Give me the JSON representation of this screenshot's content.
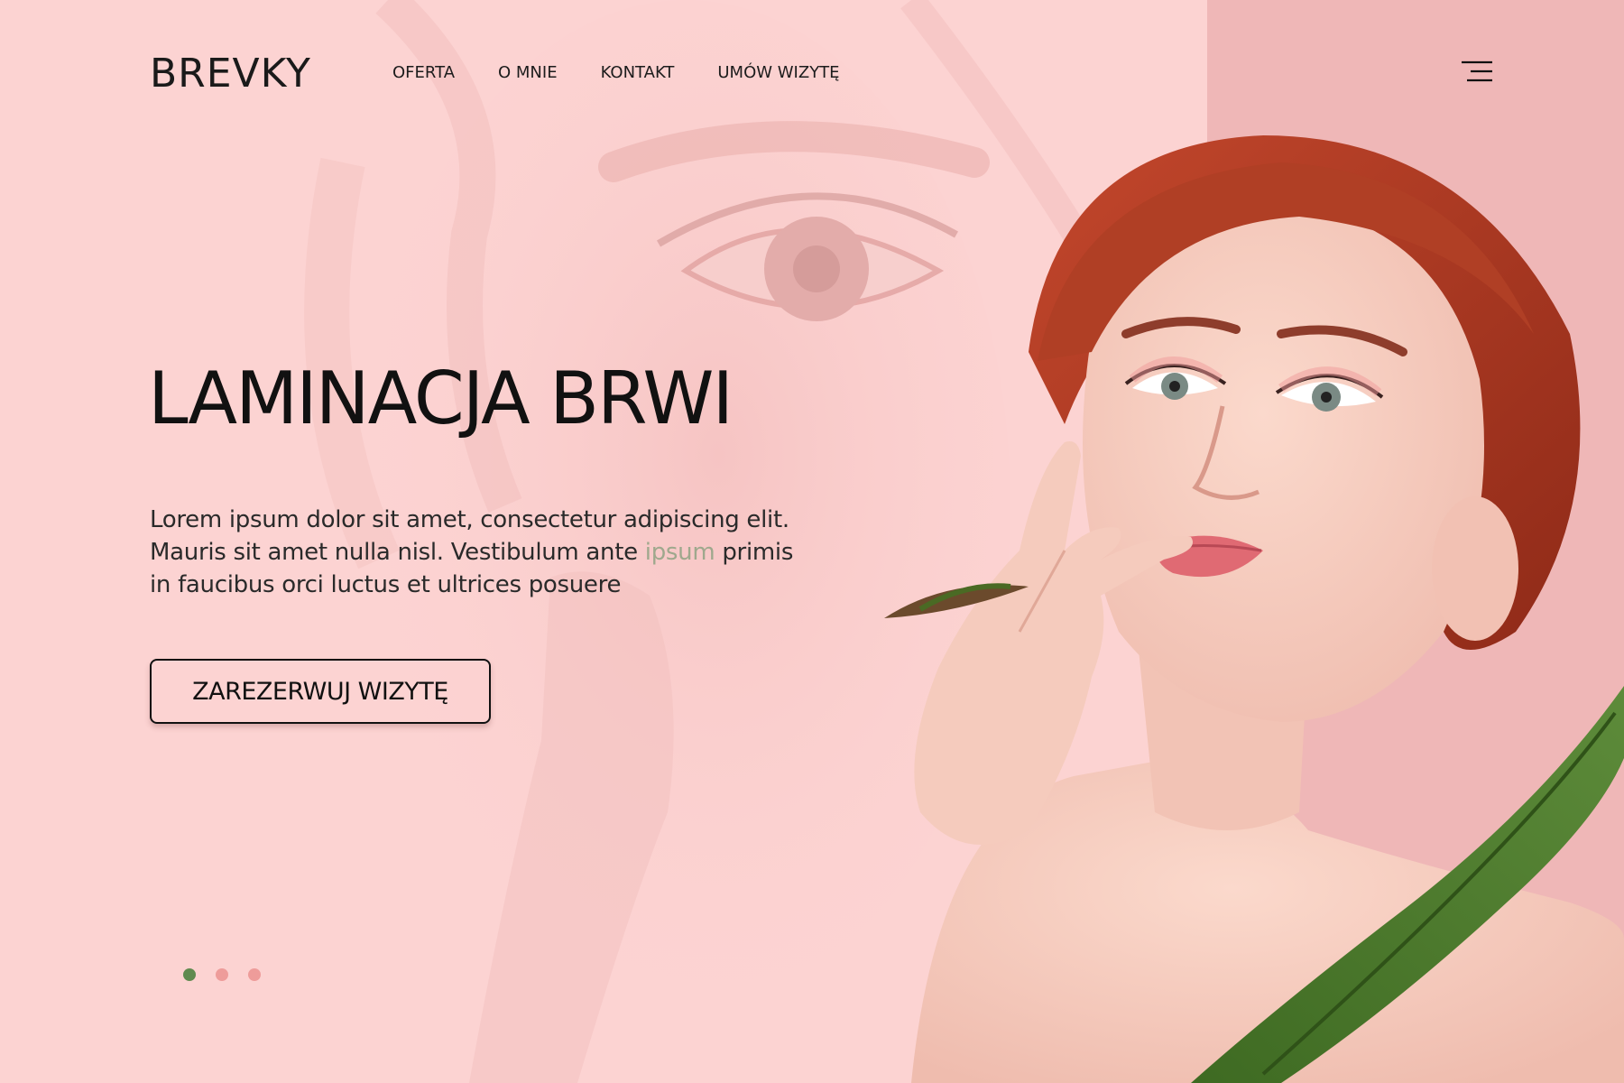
{
  "header": {
    "logo": "BREVKY",
    "nav": [
      {
        "label": "OFERTA"
      },
      {
        "label": "O MNIE"
      },
      {
        "label": "KONTAKT"
      },
      {
        "label": "UMÓW WIZYTĘ"
      }
    ],
    "menu_icon": "hamburger-menu-icon"
  },
  "hero": {
    "title": "LAMINACJA BRWI",
    "text_part1": "Lorem ipsum dolor sit amet, consectetur adipiscing elit. Mauris sit amet nulla nisl. Vestibulum ante ",
    "text_accent": "ipsum",
    "text_part2": " primis in faucibus orci luctus et ultrices posuere",
    "cta_label": "ZAREZERWUJ WIZYTĘ"
  },
  "slider": {
    "dots": [
      {
        "active": true
      },
      {
        "active": false
      },
      {
        "active": false
      }
    ],
    "active_color": "#5f8a4f",
    "inactive_color": "#ee9c9a"
  },
  "colors": {
    "background": "#fcd3d2",
    "panel": "#efb7b7",
    "text": "#111111",
    "accent_text": "#9fa88d"
  }
}
